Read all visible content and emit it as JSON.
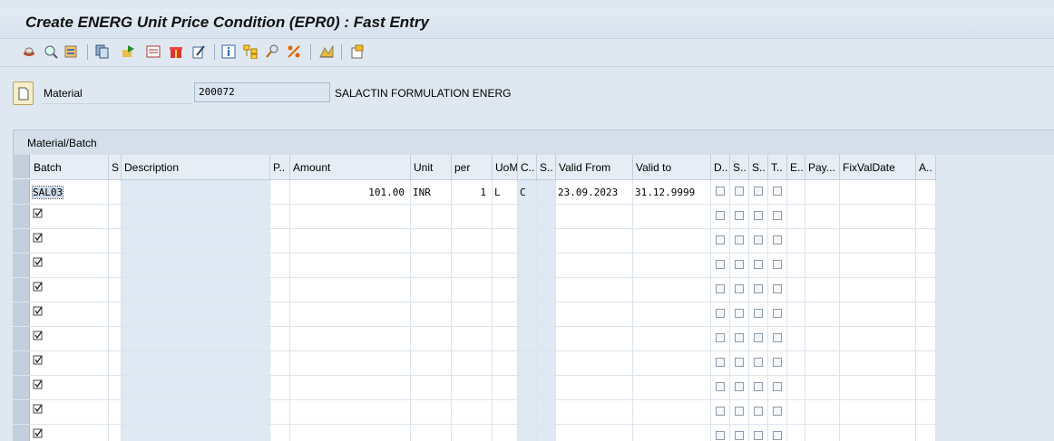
{
  "window": {
    "title": "Create ENERG Unit Price Condition (EPR0) : Fast Entry"
  },
  "toolbar": {
    "icons": [
      "save-local-icon",
      "variants-icon",
      "overview-icon",
      "copy-icon",
      "move-icon",
      "details-icon",
      "gift-icon",
      "edit-icon",
      "info-icon",
      "hierarchy-icon",
      "where-used-icon",
      "scale-icon",
      "chart-icon",
      "export-icon"
    ]
  },
  "header": {
    "material_label": "Material",
    "material_value": "200072",
    "material_description": "SALACTIN FORMULATION ENERG"
  },
  "tab": {
    "label": "Material/Batch"
  },
  "table": {
    "columns": [
      "Batch",
      "S",
      "Description",
      "P..",
      "Amount",
      "Unit",
      "per",
      "UoM",
      "C..",
      "S..",
      "Valid From",
      "Valid to",
      "D..",
      "S..",
      "S..",
      "T..",
      "E..",
      "Pay...",
      "FixValDate",
      "A.."
    ],
    "rows": [
      {
        "batch": "SAL03",
        "amount": "101.00",
        "unit": "INR",
        "per": "1",
        "uom": "L",
        "calc": "C",
        "valid_from": "23.09.2023",
        "valid_to": "31.12.9999"
      },
      {
        "batch": "",
        "amount": "",
        "unit": "",
        "per": "",
        "uom": "",
        "calc": "",
        "valid_from": "",
        "valid_to": ""
      },
      {
        "batch": "",
        "amount": "",
        "unit": "",
        "per": "",
        "uom": "",
        "calc": "",
        "valid_from": "",
        "valid_to": ""
      },
      {
        "batch": "",
        "amount": "",
        "unit": "",
        "per": "",
        "uom": "",
        "calc": "",
        "valid_from": "",
        "valid_to": ""
      },
      {
        "batch": "",
        "amount": "",
        "unit": "",
        "per": "",
        "uom": "",
        "calc": "",
        "valid_from": "",
        "valid_to": ""
      },
      {
        "batch": "",
        "amount": "",
        "unit": "",
        "per": "",
        "uom": "",
        "calc": "",
        "valid_from": "",
        "valid_to": ""
      },
      {
        "batch": "",
        "amount": "",
        "unit": "",
        "per": "",
        "uom": "",
        "calc": "",
        "valid_from": "",
        "valid_to": ""
      },
      {
        "batch": "",
        "amount": "",
        "unit": "",
        "per": "",
        "uom": "",
        "calc": "",
        "valid_from": "",
        "valid_to": ""
      },
      {
        "batch": "",
        "amount": "",
        "unit": "",
        "per": "",
        "uom": "",
        "calc": "",
        "valid_from": "",
        "valid_to": ""
      },
      {
        "batch": "",
        "amount": "",
        "unit": "",
        "per": "",
        "uom": "",
        "calc": "",
        "valid_from": "",
        "valid_to": ""
      },
      {
        "batch": "",
        "amount": "",
        "unit": "",
        "per": "",
        "uom": "",
        "calc": "",
        "valid_from": "",
        "valid_to": ""
      }
    ]
  }
}
